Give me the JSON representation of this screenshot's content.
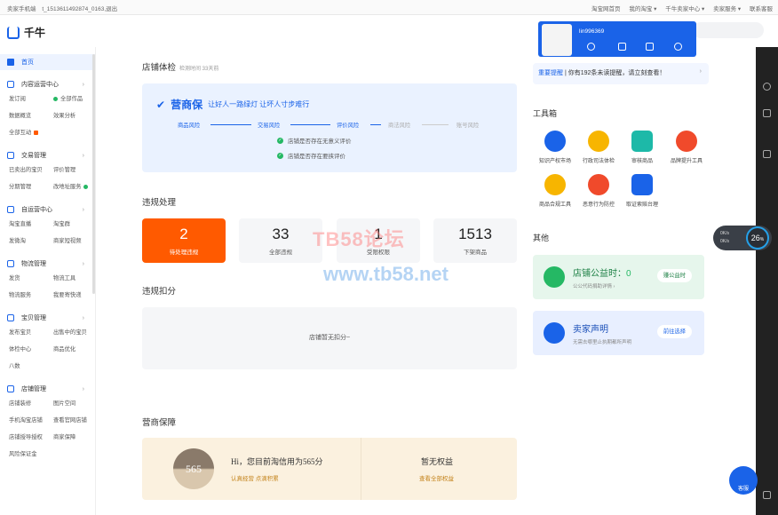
{
  "topbar": {
    "left": [
      "卖家手机端",
      "t_1513611492874_0163,退出"
    ],
    "right": [
      "淘宝网首页",
      "我的淘宝 ▾",
      "千牛卖家中心 ▾",
      "卖家服务 ▾",
      "联系客服"
    ]
  },
  "app": {
    "name": "千牛"
  },
  "sidebar": {
    "home": "首页",
    "groups": [
      {
        "title": "内容运营中心",
        "items": [
          "发订阅",
          "全部作品",
          "数据概览",
          "效果分析",
          "全部互动"
        ]
      },
      {
        "title": "交易管理",
        "items": [
          "已卖出的宝贝",
          "评价管理",
          "分期管理",
          "改地址服务"
        ]
      },
      {
        "title": "自运营中心",
        "items": [
          "淘宝直播",
          "淘宝群",
          "发微淘",
          "商家短视频"
        ]
      },
      {
        "title": "物流管理",
        "items": [
          "发货",
          "物流工具",
          "物流服务",
          "我要寄快递"
        ]
      },
      {
        "title": "宝贝管理",
        "items": [
          "发布宝贝",
          "出售中的宝贝",
          "体检中心",
          "商品优化",
          "八数"
        ]
      },
      {
        "title": "店铺管理",
        "items": [
          "店铺装修",
          "图片空间",
          "手机淘宝店铺",
          "查看官网店铺",
          "店铺授导授权",
          "商家保障",
          "风险保证金"
        ]
      }
    ]
  },
  "checkup": {
    "title": "店铺体检",
    "time": "检测时间 33天前",
    "slogan_logo": "营商保",
    "slogan": "让好人一路绿灯 让坏人寸步难行",
    "steps": [
      "商品风险",
      "交易风险",
      "评价风险",
      "商法风险",
      "账号风险"
    ],
    "checks": [
      "店铺是否存在无意义评价",
      "店铺是否存在要挟评价"
    ]
  },
  "violations": {
    "title": "违规处理",
    "stats": [
      {
        "value": "2",
        "label": "待处理违规"
      },
      {
        "value": "33",
        "label": "全部违规"
      },
      {
        "value": "1",
        "label": "受限权限"
      },
      {
        "value": "1513",
        "label": "下架商品"
      }
    ]
  },
  "deduction": {
    "title": "违规扣分",
    "empty": "店铺暂无扣分~"
  },
  "guarantee": {
    "title": "营商保障",
    "score": "565",
    "credit_text": "Hi，您目前淘信用为565分",
    "credit_link": "认真经营 点滴积累",
    "rights_title": "暂无权益",
    "rights_link": "查看全部权益"
  },
  "notice": {
    "label": "重要提醒",
    "text": "| 你有192条未读提醒，请立刻查看！",
    "arrow": "›"
  },
  "tools": {
    "title": "工具箱",
    "items": [
      {
        "label": "知识产权市场",
        "color": "#1a63e8"
      },
      {
        "label": "行政司法体检",
        "color": "#f7b500"
      },
      {
        "label": "审核商品",
        "color": "#1db9a8"
      },
      {
        "label": "品牌提升工具",
        "color": "#f04a2b"
      },
      {
        "label": "商品合规工具",
        "color": "#f7b500"
      },
      {
        "label": "恶意行为防控",
        "color": "#f04a2b"
      },
      {
        "label": "取证索赔台理",
        "color": "#1a63e8"
      }
    ]
  },
  "other": {
    "title": "其他",
    "cards": [
      {
        "title": "店铺公益时：",
        "value": "0",
        "sub": "公公代码捐助详情 ›",
        "btn": "赚公益时"
      },
      {
        "title": "卖家声明",
        "value": "",
        "sub": "无需去哪里止执期都所声明",
        "btn": "前往选择"
      }
    ]
  },
  "popup": {
    "user": "lin996369"
  },
  "speed": {
    "pct": "26",
    "unit": "%",
    "up": "0K/s",
    "down": "0K/s"
  },
  "kefu": "客服",
  "watermark": {
    "line1": "TB58论坛",
    "line2": "www.tb58.net"
  }
}
